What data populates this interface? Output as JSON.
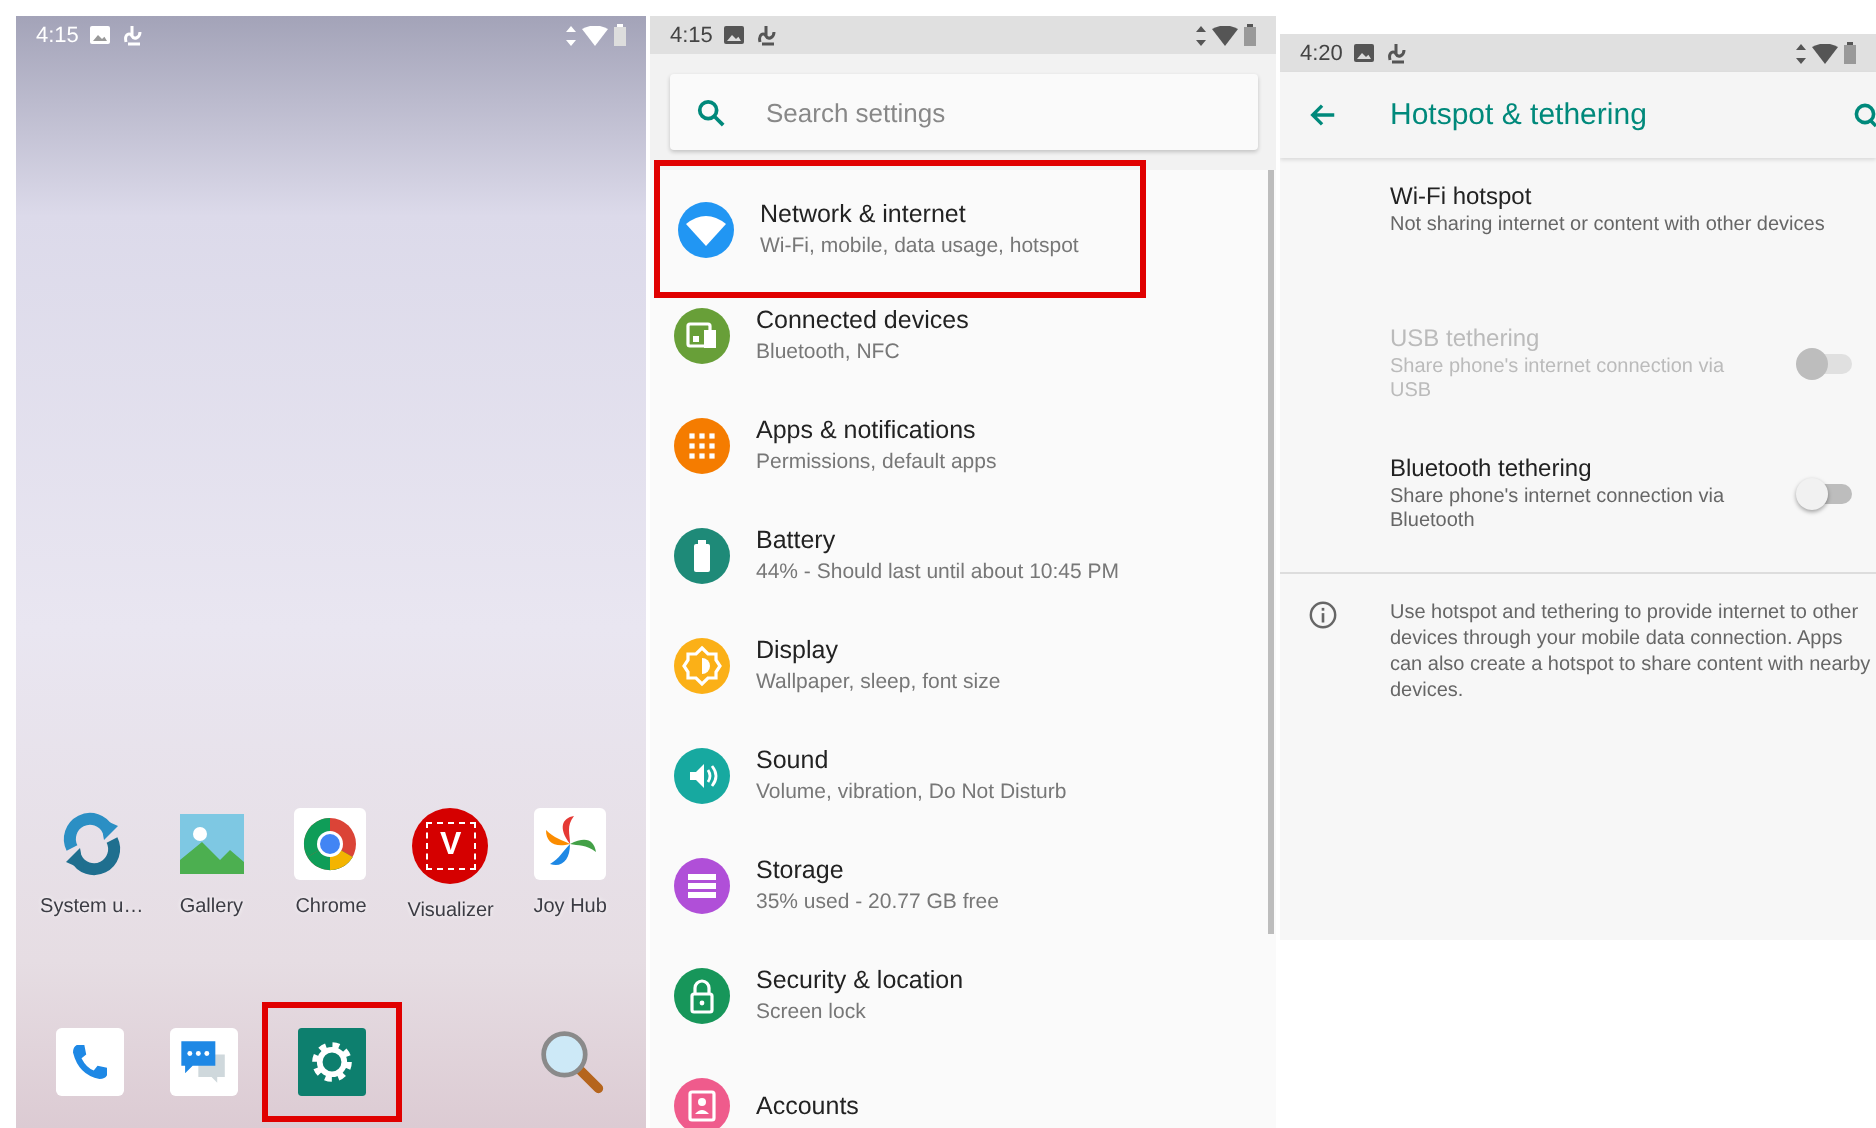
{
  "home_screen": {
    "status_bar": {
      "time": "4:15"
    },
    "apps": [
      {
        "label": "System u…",
        "kind": "sync"
      },
      {
        "label": "Gallery",
        "kind": "gallery"
      },
      {
        "label": "Chrome",
        "kind": "browser"
      },
      {
        "label": "Visualizer",
        "kind": "visualizer",
        "icon_letter": "V"
      },
      {
        "label": "Joy Hub",
        "kind": "pinwheel"
      }
    ],
    "dock": [
      {
        "kind": "phone",
        "highlighted": false
      },
      {
        "kind": "messages",
        "highlighted": false
      },
      {
        "kind": "settings",
        "highlighted": true
      },
      {
        "kind": "search",
        "highlighted": false
      }
    ]
  },
  "settings_screen": {
    "status_bar": {
      "time": "4:15"
    },
    "search": {
      "placeholder": "Search settings"
    },
    "items": [
      {
        "title": "Network & internet",
        "subtitle": "Wi-Fi, mobile, data usage, hotspot",
        "kind": "wifi",
        "color": "#2196f3",
        "highlighted": true
      },
      {
        "title": "Connected devices",
        "subtitle": "Bluetooth, NFC",
        "kind": "devices",
        "color": "#689f38",
        "highlighted": false
      },
      {
        "title": "Apps & notifications",
        "subtitle": "Permissions, default apps",
        "kind": "apps",
        "color": "#f57c00",
        "highlighted": false
      },
      {
        "title": "Battery",
        "subtitle": "44% - Should last until about 10:45 PM",
        "kind": "battery",
        "color": "#1e8a78",
        "highlighted": false
      },
      {
        "title": "Display",
        "subtitle": "Wallpaper, sleep, font size",
        "kind": "display",
        "color": "#fbb017",
        "highlighted": false
      },
      {
        "title": "Sound",
        "subtitle": "Volume, vibration, Do Not Disturb",
        "kind": "sound",
        "color": "#17a9a0",
        "highlighted": false
      },
      {
        "title": "Storage",
        "subtitle": "35% used - 20.77 GB free",
        "kind": "storage",
        "color": "#b04fd8",
        "highlighted": false
      },
      {
        "title": "Security & location",
        "subtitle": "Screen lock",
        "kind": "security",
        "color": "#17965a",
        "highlighted": false
      },
      {
        "title": "Accounts",
        "kind": "accounts",
        "color": "#ef5b8c",
        "highlighted": false
      }
    ]
  },
  "hotspot_screen": {
    "status_bar": {
      "time": "4:20"
    },
    "title": "Hotspot & tethering",
    "items": [
      {
        "title": "Wi-Fi hotspot",
        "subtitle": "Not sharing internet or content with other devices",
        "kind": "plain",
        "disabled": false
      },
      {
        "title": "USB tethering",
        "subtitle": "Share phone's internet connection via USB",
        "kind": "toggle",
        "disabled": true,
        "on": false
      },
      {
        "title": "Bluetooth tethering",
        "subtitle": "Share phone's internet connection via Bluetooth",
        "kind": "toggle",
        "disabled": false,
        "on": false
      }
    ],
    "info": "Use hotspot and tethering to provide internet to other devices through your mobile data connection. Apps can also create a hotspot to share content with nearby devices."
  }
}
